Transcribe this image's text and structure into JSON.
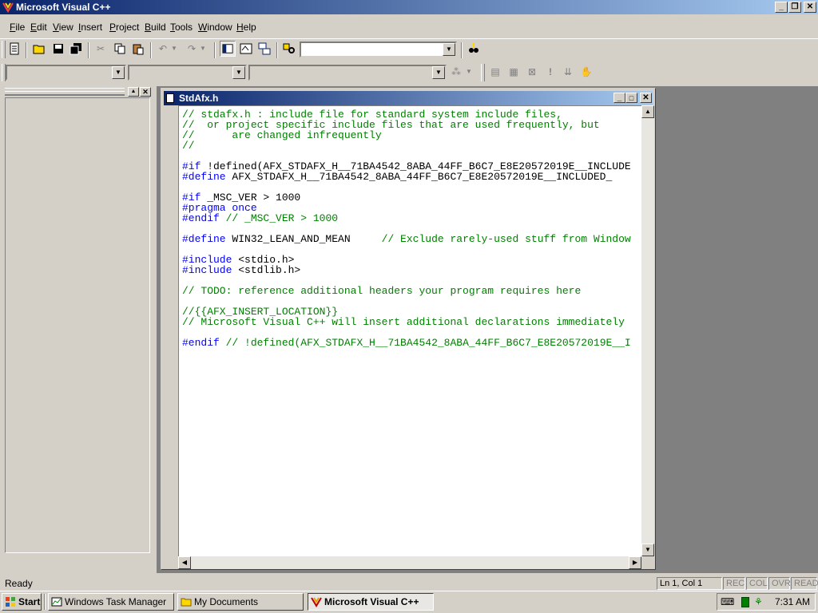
{
  "app": {
    "title": "Microsoft Visual C++"
  },
  "menu": [
    "File",
    "Edit",
    "View",
    "Insert",
    "Project",
    "Build",
    "Tools",
    "Window",
    "Help"
  ],
  "menu_underline": [
    "F",
    "E",
    "V",
    "I",
    "P",
    "B",
    "T",
    "W",
    "H"
  ],
  "document": {
    "title": "StdAfx.h",
    "lines": [
      "// stdafx.h : include file for standard system include files,",
      "//  or project specific include files that are used frequently, but",
      "//      are changed infrequently",
      "//",
      "",
      "#if !defined(AFX_STDAFX_H__71BA4542_8ABA_44FF_B6C7_E8E20572019E__INCLUDE",
      "#define AFX_STDAFX_H__71BA4542_8ABA_44FF_B6C7_E8E20572019E__INCLUDED_",
      "",
      "#if _MSC_VER > 1000",
      "#pragma once",
      "#endif // _MSC_VER > 1000",
      "",
      "#define WIN32_LEAN_AND_MEAN     // Exclude rarely-used stuff from Window",
      "",
      "#include <stdio.h>",
      "#include <stdlib.h>",
      "",
      "// TODO: reference additional headers your program requires here",
      "",
      "//{{AFX_INSERT_LOCATION}}",
      "// Microsoft Visual C++ will insert additional declarations immediately",
      "",
      "#endif // !defined(AFX_STDAFX_H__71BA4542_8ABA_44FF_B6C7_E8E20572019E__I"
    ]
  },
  "status": {
    "text": "Ready",
    "position": "Ln 1, Col 1",
    "indicators": [
      "REC",
      "COL",
      "OVR",
      "READ"
    ]
  },
  "taskbar": {
    "start": "Start",
    "tasks": [
      "Windows Task Manager",
      "My Documents",
      "Microsoft Visual C++"
    ],
    "clock": "7:31 AM"
  }
}
